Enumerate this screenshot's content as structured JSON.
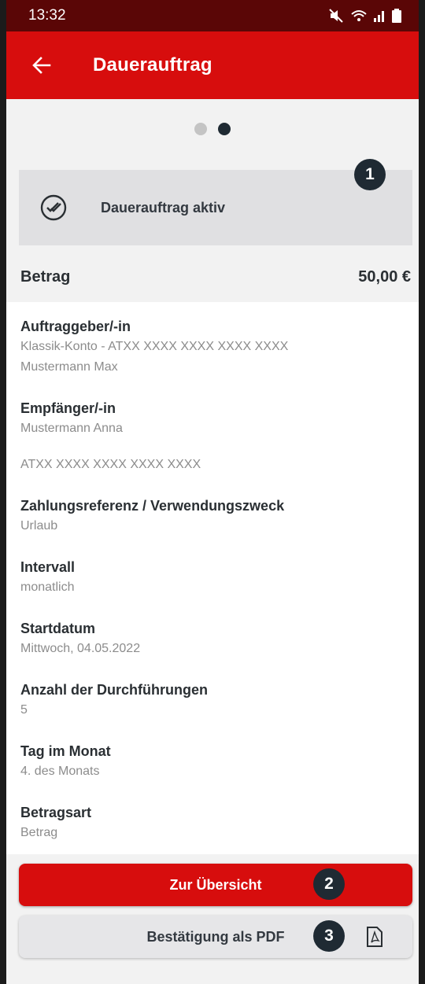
{
  "status_bar": {
    "time": "13:32"
  },
  "app_bar": {
    "title": "Dauerauftrag"
  },
  "pager": {
    "total": 2,
    "active": 2
  },
  "status_card": {
    "label": "Dauerauftrag aktiv"
  },
  "amount": {
    "label": "Betrag",
    "value": "50,00 €"
  },
  "fields": {
    "orderer": {
      "label": "Auftraggeber/-in",
      "account": "Klassik-Konto - ATXX XXXX XXXX XXXX XXXX",
      "name": "Mustermann Max"
    },
    "recipient": {
      "label": "Empfänger/-in",
      "name": "Mustermann Anna",
      "iban": "ATXX XXXX XXXX XXXX XXXX"
    },
    "reference": {
      "label": "Zahlungsreferenz / Verwendungszweck",
      "value": "Urlaub"
    },
    "interval": {
      "label": "Intervall",
      "value": "monatlich"
    },
    "start_date": {
      "label": "Startdatum",
      "value": "Mittwoch, 04.05.2022"
    },
    "executions": {
      "label": "Anzahl der Durchführungen",
      "value": "5"
    },
    "day_of_month": {
      "label": "Tag im Monat",
      "value": "4. des Monats"
    },
    "amount_type": {
      "label": "Betragsart",
      "value": "Betrag"
    }
  },
  "buttons": {
    "overview": "Zur Übersicht",
    "pdf": "Bestätigung als PDF"
  },
  "markers": [
    "1",
    "2",
    "3"
  ],
  "colors": {
    "brand_red": "#d70d0d",
    "status_bar": "#5a0606",
    "marker": "#1f2a33"
  }
}
